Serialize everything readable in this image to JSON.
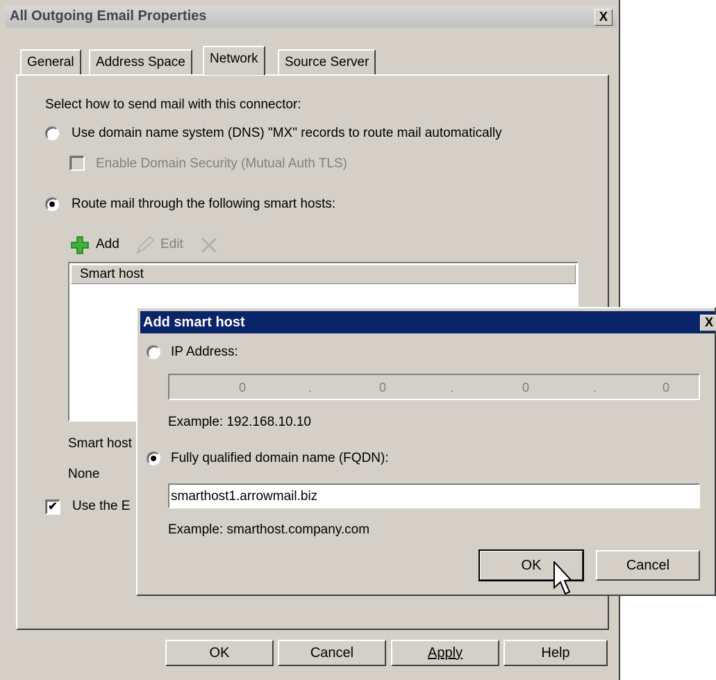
{
  "main_dialog": {
    "title": "All Outgoing Email Properties",
    "close_glyph": "X",
    "tabs": [
      "General",
      "Address Space",
      "Network",
      "Source Server"
    ],
    "active_tab": "Network",
    "prompt": "Select how to send mail with this connector:",
    "dns_option": "Use domain name system (DNS) \"MX\" records to route mail automatically",
    "domain_security": "Enable Domain Security (Mutual Auth TLS)",
    "smarthost_option": "Route mail through the following smart hosts:",
    "toolbar": {
      "add": "Add",
      "edit": "Edit"
    },
    "list_header": "Smart host",
    "auth_label": "Smart host",
    "auth_value": "None",
    "use_the_checkbox": "Use the E",
    "buttons": {
      "ok": "OK",
      "cancel": "Cancel",
      "apply": "Apply",
      "help": "Help"
    }
  },
  "smart_host_dialog": {
    "title": "Add smart host",
    "close_glyph": "X",
    "ip_label": "IP Address:",
    "ip_segments": [
      "0",
      "0",
      "0",
      "0"
    ],
    "ip_example": "Example: 192.168.10.10",
    "fqdn_label": "Fully qualified domain name (FQDN):",
    "fqdn_value": "smarthost1.arrowmail.biz",
    "fqdn_example": "Example: smarthost.company.com",
    "buttons": {
      "ok": "OK",
      "cancel": "Cancel"
    }
  },
  "colors": {
    "dialog_bg": "#d4d0c8",
    "active_title": "#0a246a",
    "inactive_title": "#c0c0c0",
    "add_icon": "#3cb43c"
  }
}
